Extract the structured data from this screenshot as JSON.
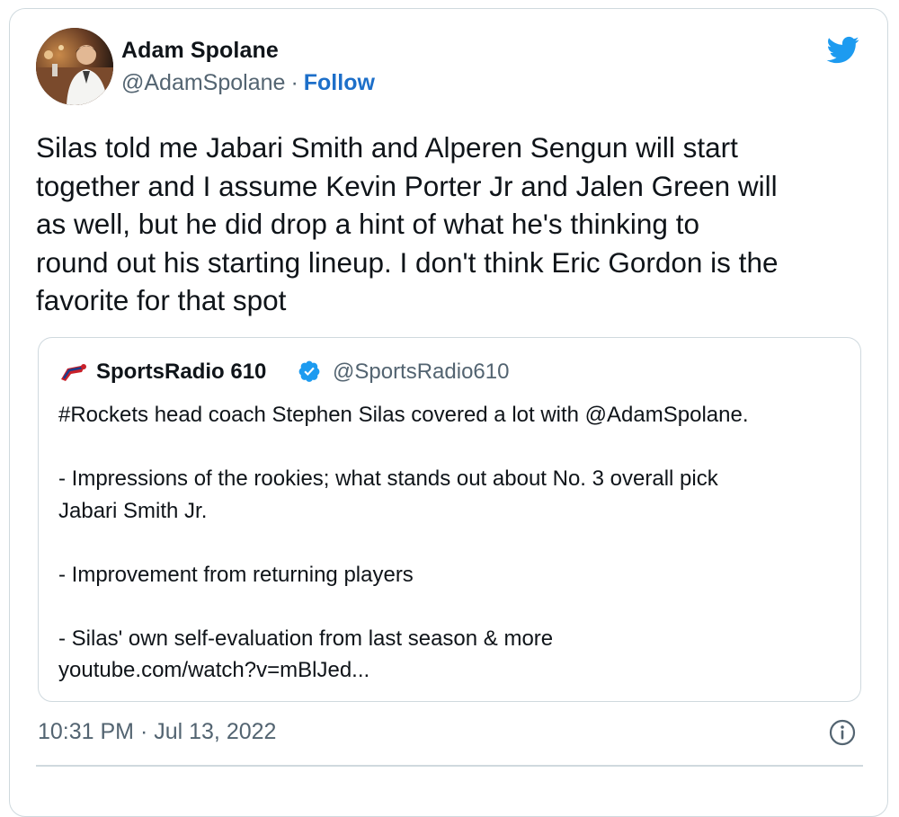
{
  "author": {
    "name": "Adam Spolane",
    "handle": "@AdamSpolane",
    "separator": "·",
    "follow_label": "Follow"
  },
  "tweet": {
    "lines": [
      "Silas told me Jabari Smith and Alperen Sengun will start",
      "together and I assume Kevin Porter Jr and Jalen Green will",
      "as well, but he did drop a hint of what he's thinking to",
      "round out his starting lineup. I don't think Eric Gordon is the",
      "favorite for that spot"
    ]
  },
  "quoted": {
    "name": "SportsRadio 610",
    "handle": "@SportsRadio610",
    "verified": true,
    "lines": [
      "#Rockets head coach Stephen Silas covered a lot with @AdamSpolane.",
      "",
      "- Impressions of the rookies; what stands out about No. 3 overall pick",
      "Jabari Smith Jr.",
      "",
      "- Improvement from returning players",
      "",
      "- Silas' own self-evaluation from last season & more",
      "youtube.com/watch?v=mBlJed..."
    ]
  },
  "meta": {
    "timestamp": "10:31 PM · Jul 13, 2022"
  },
  "icons": {
    "brand": "twitter-bird-icon",
    "verified": "verified-badge-icon",
    "info": "info-icon"
  },
  "colors": {
    "twitter_blue": "#1d9bf0",
    "link_blue": "#1d6fc9",
    "text": "#0f1419",
    "secondary": "#536471",
    "border": "#cfd9de"
  }
}
